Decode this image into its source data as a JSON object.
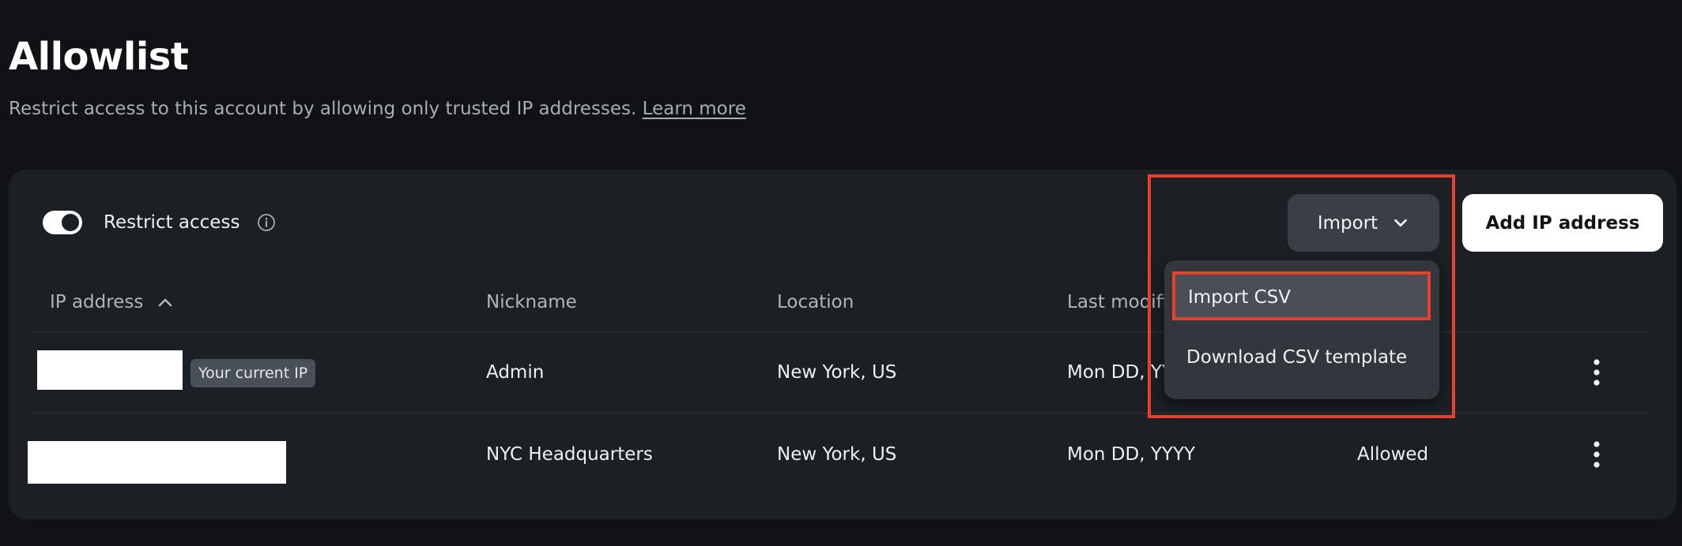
{
  "header": {
    "title": "Allowlist",
    "subtitle": "Restrict access to this account by allowing only trusted IP addresses.",
    "learn_more": "Learn more"
  },
  "controls": {
    "restrict_label": "Restrict access",
    "restrict_enabled": true,
    "import_label": "Import",
    "add_label": "Add IP address"
  },
  "table": {
    "columns": [
      "IP address",
      "Nickname",
      "Location",
      "Last modified"
    ],
    "rows": [
      {
        "ip": "",
        "badge": "Your current IP",
        "nickname": "Admin",
        "location": "New York, US",
        "modified": "Mon DD, YYYY",
        "status": ""
      },
      {
        "ip": "",
        "badge": "",
        "nickname": "NYC Headquarters",
        "location": "New York, US",
        "modified": "Mon DD, YYYY",
        "status": "Allowed"
      }
    ]
  },
  "dropdown": {
    "items": [
      "Import CSV",
      "Download CSV template"
    ],
    "selected": "Import CSV"
  },
  "colors": {
    "background": "#101216",
    "card": "#1c1f24",
    "highlight": "#e8402b"
  }
}
